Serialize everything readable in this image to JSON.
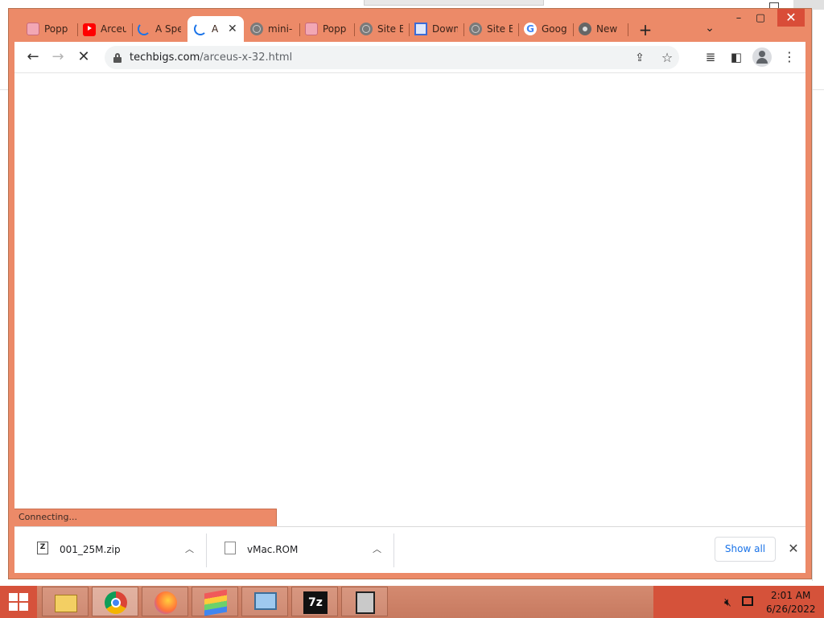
{
  "browser": {
    "tabs": [
      {
        "title": "Popp",
        "favicon": "pink-square-icon"
      },
      {
        "title": "Arceu",
        "favicon": "youtube-icon"
      },
      {
        "title": "A Spe",
        "favicon": "loading-spinner-icon"
      },
      {
        "title": "A",
        "favicon": "loading-spinner-icon",
        "active": true
      },
      {
        "title": "mini-",
        "favicon": "globe-icon"
      },
      {
        "title": "Popp",
        "favicon": "pink-square-icon"
      },
      {
        "title": "Site E",
        "favicon": "globe-icon"
      },
      {
        "title": "Down",
        "favicon": "document-icon"
      },
      {
        "title": "Site E",
        "favicon": "globe-icon"
      },
      {
        "title": "Goog",
        "favicon": "google-icon"
      },
      {
        "title": "New",
        "favicon": "chrome-icon"
      }
    ],
    "url_domain": "techbigs.com",
    "url_path": "/arceus-x-32.html",
    "status": "Connecting..."
  },
  "downloads": {
    "items": [
      {
        "name": "001_25M.zip"
      },
      {
        "name": "vMac.ROM"
      }
    ],
    "show_all_label": "Show all"
  },
  "taskbar": {
    "apps": [
      "file-explorer",
      "chrome",
      "firefox",
      "bluestacks",
      "control-panel",
      "7-zip",
      "virtualbox"
    ],
    "time": "2:01 AM",
    "date": "6/26/2022"
  },
  "colors": {
    "frame": "#ec8a68",
    "taskbar": "#c77a60",
    "tray": "#d5523a",
    "link": "#1a73e8"
  }
}
